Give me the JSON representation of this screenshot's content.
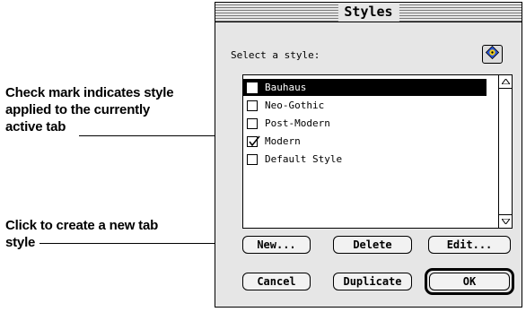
{
  "dialog": {
    "title": "Styles",
    "select_label": "Select a style:",
    "styles": [
      {
        "name": "Bauhaus",
        "checked": false,
        "selected": true
      },
      {
        "name": "Neo-Gothic",
        "checked": false,
        "selected": false
      },
      {
        "name": "Post-Modern",
        "checked": false,
        "selected": false
      },
      {
        "name": "Modern",
        "checked": true,
        "selected": false
      },
      {
        "name": "Default Style",
        "checked": false,
        "selected": false
      }
    ],
    "buttons": {
      "new": "New...",
      "delete": "Delete",
      "edit": "Edit...",
      "cancel": "Cancel",
      "duplicate": "Duplicate",
      "ok": "OK"
    },
    "help_icon": "balloon-help-icon"
  },
  "callouts": {
    "checkmark_line1": "Check mark indicates style",
    "checkmark_line2": "applied to the currently",
    "checkmark_line3": "active tab",
    "new_line1": "Click to create a new tab",
    "new_line2": "style"
  },
  "colors": {
    "selection": "#000000",
    "help_icon_blue": "#2b55d8",
    "help_icon_yellow": "#f0d020"
  }
}
